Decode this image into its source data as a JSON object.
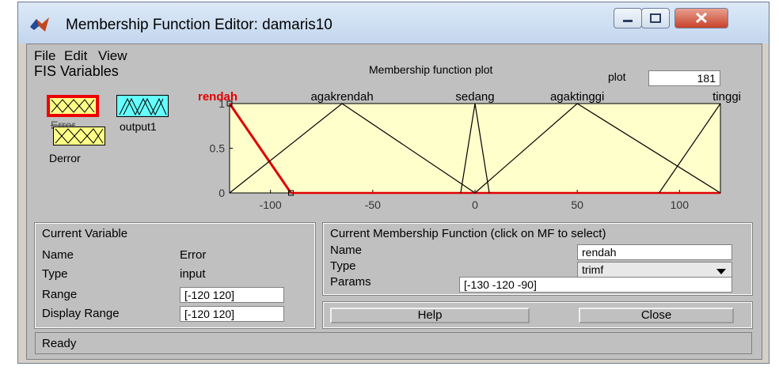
{
  "window": {
    "title": "Membership Function Editor: damaris10"
  },
  "menu": [
    "File",
    "Edit",
    "View"
  ],
  "fis_variables": {
    "heading": "FIS Variables",
    "inputs": [
      {
        "label": "Error",
        "selected": true
      },
      {
        "label": "Derror",
        "selected": false
      }
    ],
    "outputs": [
      {
        "label": "output1"
      }
    ]
  },
  "plot_header": {
    "title": "Membership function plot",
    "plot_points_label": "plot",
    "plot_points_value": "181"
  },
  "current_variable": {
    "heading": "Current Variable",
    "name_label": "Name",
    "name_value": "Error",
    "type_label": "Type",
    "type_value": "input",
    "range_label": "Range",
    "range_value": "[-120 120]",
    "display_range_label": "Display Range",
    "display_range_value": "[-120 120]"
  },
  "current_mf": {
    "heading": "Current Membership Function (click on MF to select)",
    "name_label": "Name",
    "name_value": "rendah",
    "type_label": "Type",
    "type_value": "trimf",
    "params_label": "Params",
    "params_value": "[-130 -120 -90]"
  },
  "buttons": {
    "help": "Help",
    "close": "Close"
  },
  "status": "Ready",
  "chart_data": {
    "type": "line",
    "xlim": [
      -120,
      120
    ],
    "ylim": [
      0,
      1
    ],
    "x_ticks": [
      "-100",
      "-50",
      "0",
      "50",
      "100"
    ],
    "y_ticks": [
      "0",
      "0.5",
      "1"
    ],
    "series": [
      {
        "name": "rendah",
        "points": [
          [
            -120,
            1
          ],
          [
            -90,
            0
          ]
        ],
        "color": "#e00000",
        "selected": true
      },
      {
        "name": "agakrendah",
        "points": [
          [
            -120,
            0
          ],
          [
            -65,
            1
          ],
          [
            0,
            0
          ]
        ],
        "color": "#000000"
      },
      {
        "name": "sedang",
        "points": [
          [
            -7,
            0
          ],
          [
            0,
            1
          ],
          [
            7,
            0
          ]
        ],
        "color": "#000000"
      },
      {
        "name": "agaktinggi",
        "points": [
          [
            0,
            0
          ],
          [
            50,
            1
          ],
          [
            120,
            0
          ]
        ],
        "color": "#000000"
      },
      {
        "name": "tinggi",
        "points": [
          [
            90,
            0
          ],
          [
            120,
            1
          ]
        ],
        "color": "#000000"
      }
    ],
    "colors": {
      "plot_bg": "#ffffcc",
      "selected": "#e00000",
      "normal": "#000000"
    }
  }
}
